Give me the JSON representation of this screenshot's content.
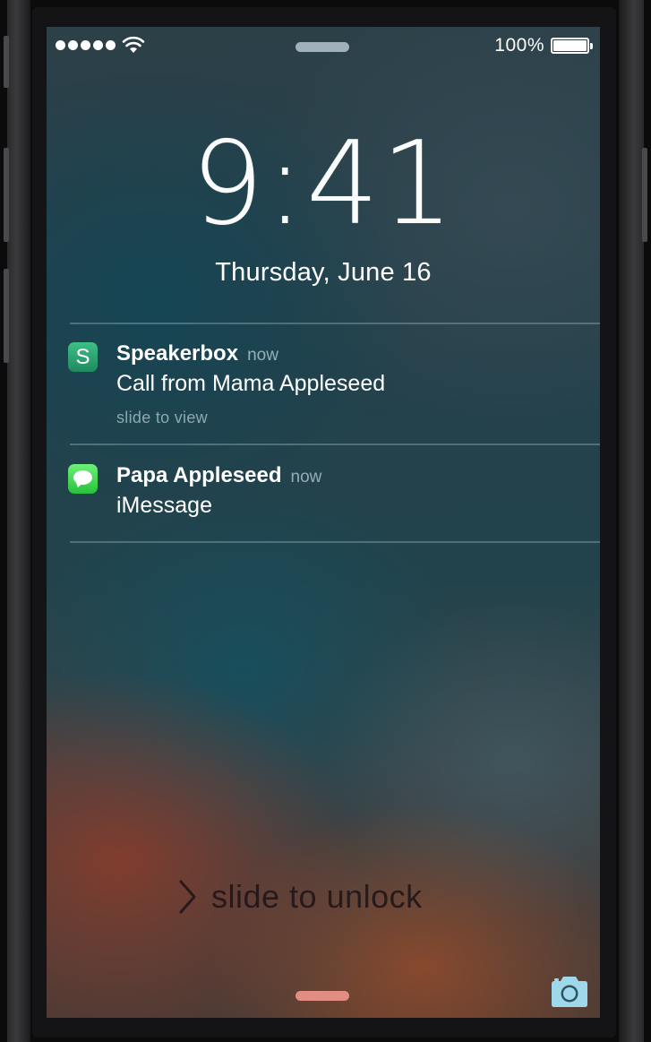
{
  "status_bar": {
    "signal_dots": 5,
    "battery_percent_label": "100%",
    "battery_level": 1.0,
    "wifi_icon": "wifi-icon",
    "battery_icon": "battery-icon"
  },
  "lock_screen": {
    "time": "9:41",
    "date": "Thursday, June 16",
    "unlock_hint": "slide to unlock",
    "unlock_icon": "chevron-right-icon",
    "camera_icon": "camera-icon"
  },
  "notifications": [
    {
      "app_icon": "speakerbox-icon",
      "icon_letter": "S",
      "title": "Speakerbox",
      "time": "now",
      "body": "Call from Mama Appleseed",
      "action": "slide to view"
    },
    {
      "app_icon": "messages-icon",
      "title": "Papa Appleseed",
      "time": "now",
      "body": "iMessage"
    }
  ],
  "colors": {
    "speakerbox_icon": "#2ea574",
    "messages_icon": "#3ed654",
    "camera_icon": "#9fd8ea",
    "bottom_grabber": "#f0968c"
  }
}
